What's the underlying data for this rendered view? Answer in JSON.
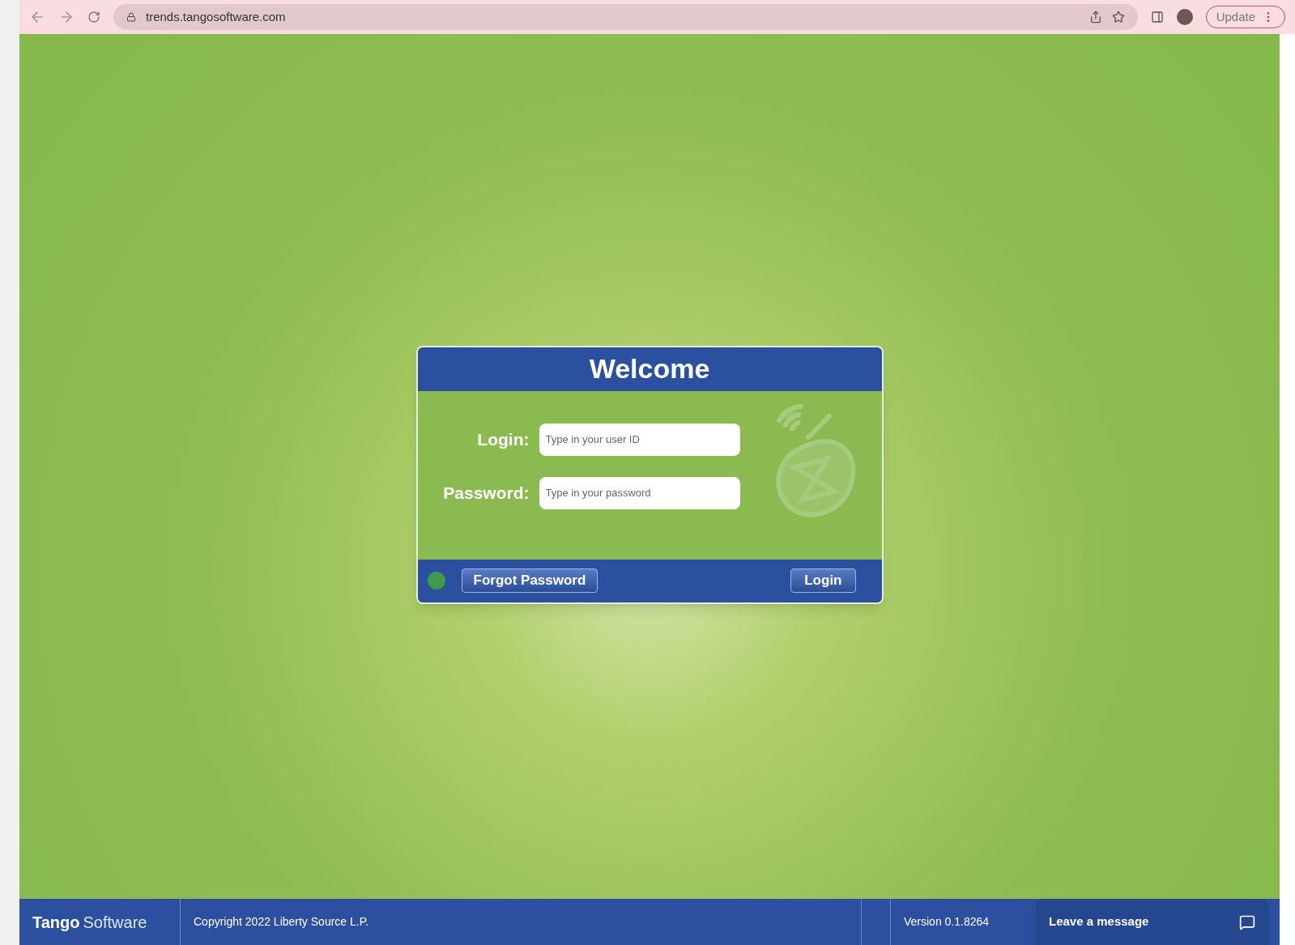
{
  "browser": {
    "url": "trends.tangosoftware.com",
    "update_button": "Update"
  },
  "login_card": {
    "title": "Welcome",
    "fields": [
      {
        "label": "Login:",
        "placeholder": "Type in your user ID"
      },
      {
        "label": "Password:",
        "placeholder": "Type in your password"
      }
    ],
    "status_dot": {
      "color": "#3f9a4a"
    },
    "buttons": [
      "Forgot Password",
      "Login"
    ]
  },
  "footer": {
    "brand_bold": "Tango",
    "brand_light": "Software",
    "copyright": "Copyright 2022 Liberty Source L.P.",
    "version": "Version 0.1.8264",
    "chat_button": "Leave a message"
  }
}
